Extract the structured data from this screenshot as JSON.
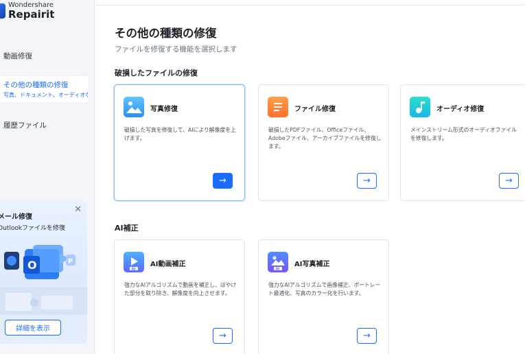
{
  "app": {
    "brand": "Wondershare",
    "product": "Repairit"
  },
  "sidebar": {
    "items": [
      {
        "label": "動画修復"
      },
      {
        "label": "その他の種類の修復",
        "sub": "写真、ドキュメント、オーディオなど。"
      },
      {
        "label": "履歴ファイル"
      }
    ],
    "promo": {
      "title": "メール修復",
      "desc": "Outlookファイルを修復",
      "button": "詳細を表示"
    }
  },
  "main": {
    "title": "その他の種類の修復",
    "subtitle": "ファイルを修復する機能を選択します",
    "sections": [
      {
        "title": "破損したファイルの修復",
        "cards": [
          {
            "title": "写真修復",
            "desc": "破損した写真を修復して、AIにより解像度を上げます。"
          },
          {
            "title": "ファイル修復",
            "desc": "破損したPDFファイル、Officeファイル、Adobeファイル、アーカイブファイルを修復します。"
          },
          {
            "title": "オーディオ修復",
            "desc": "メインストリーム形式のオーディオファイルを修復します。"
          }
        ]
      },
      {
        "title": "AI補正",
        "cards": [
          {
            "title": "AI動画補正",
            "desc": "強力なAIアルゴリズムで動画を補正し、ぼやけた部分を取り除き、解像度を向上させます。"
          },
          {
            "title": "AI写真補正",
            "desc": "強力なAIアルゴリズムで画像補正、ポートレート最適化、写真のカラー化を行います。"
          }
        ]
      }
    ],
    "arrow_glyph": "→"
  },
  "icons": {
    "photo": "image-icon",
    "file": "document-icon",
    "audio": "music-note-icon",
    "video": "ai-video-icon",
    "ai_photo": "ai-image-icon",
    "close": "close-icon"
  },
  "colors": {
    "accent": "#1a6cff",
    "sidebar_bg": "#f3f5f9"
  }
}
